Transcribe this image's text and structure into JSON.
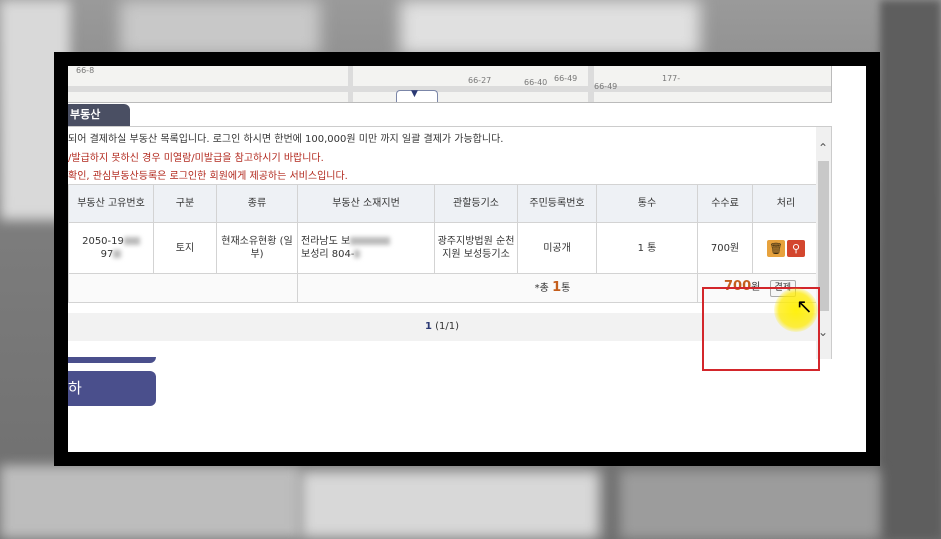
{
  "map": {
    "labels": [
      "66-8",
      "66-27",
      "66-40",
      "66-49",
      "66-49",
      "177-"
    ],
    "toggle_icon": "chevron-down-icon"
  },
  "section": {
    "tab_label": "부동산"
  },
  "notices": [
    "되어 결제하실 부동산 목록입니다.  로그인 하시면 한번에 100,000원 미만 까지 일괄 결제가 가능합니다.",
    "/발급하지 못하신 경우 미열람/미발급을 참고하시기 바랍니다.",
    "확인, 관심부동산등록은 로그인한 회원에게 제공하는 서비스입니다."
  ],
  "table": {
    "headers": [
      "부동산 고유번호",
      "구분",
      "종류",
      "부동산 소재지번",
      "관할등기소",
      "주민등록번호",
      "통수",
      "수수료",
      "처리"
    ],
    "rows": [
      {
        "id_line1": "2050-19",
        "id_line2": "97",
        "type": "토지",
        "kind": "현재소유현황 (일부)",
        "addr_line1": "전라남도 보",
        "addr_line2": "보성리 804-",
        "registry": "광주지방법원 순천지원 보성등기소",
        "resident_no": "미공개",
        "copies": "1 통",
        "fee": "700원"
      }
    ],
    "total": {
      "label": "*총",
      "count": "1",
      "unit": "통",
      "amount": "700",
      "amount_unit": "원",
      "pay_label": "결제"
    }
  },
  "pager": {
    "current": "1",
    "range": "(1/1)"
  },
  "left_button": {
    "label": "하"
  },
  "colors": {
    "accent": "#4a4f8c",
    "notice_red": "#b2281d",
    "highlight_box": "#d3262b",
    "amount": "#c45e1c"
  }
}
